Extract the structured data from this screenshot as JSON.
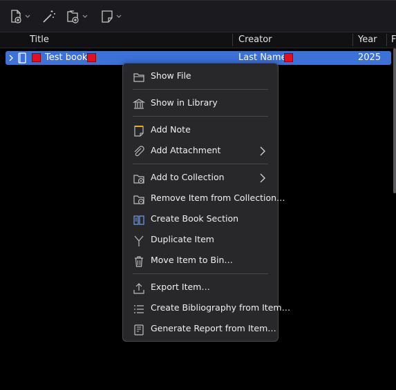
{
  "toolbar": {
    "buttons": [
      {
        "icon": "new-item-icon"
      },
      {
        "icon": "magic-wand-icon"
      },
      {
        "icon": "new-collection-icon"
      },
      {
        "icon": "new-note-icon"
      }
    ]
  },
  "columns": {
    "title": "Title",
    "creator": "Creator",
    "year": "Year",
    "extra": "F"
  },
  "row": {
    "title": "Test book",
    "creator": "Last Name",
    "year": "2025",
    "tag_color": "#e5101e",
    "item_icon": "book-icon"
  },
  "menu": {
    "items": [
      {
        "label": "Show File",
        "icon": "folder-icon"
      },
      {
        "label": "Show in Library",
        "icon": "library-icon"
      },
      {
        "label": "Add Note",
        "icon": "note-icon"
      },
      {
        "label": "Add Attachment",
        "icon": "paperclip-icon",
        "submenu": true
      },
      {
        "label": "Add to Collection",
        "icon": "collection-add-icon",
        "submenu": true
      },
      {
        "label": "Remove Item from Collection…",
        "icon": "collection-remove-icon"
      },
      {
        "label": "Create Book Section",
        "icon": "book-section-icon"
      },
      {
        "label": "Duplicate Item",
        "icon": "duplicate-icon"
      },
      {
        "label": "Move Item to Bin…",
        "icon": "trash-icon"
      },
      {
        "label": "Export Item…",
        "icon": "export-icon"
      },
      {
        "label": "Create Bibliography from Item…",
        "icon": "bibliography-icon"
      },
      {
        "label": "Generate Report from Item…",
        "icon": "report-icon"
      }
    ]
  },
  "colors": {
    "selection": "#3c72d8",
    "menu_bg": "#28282b",
    "tag_red": "#e5101e"
  }
}
